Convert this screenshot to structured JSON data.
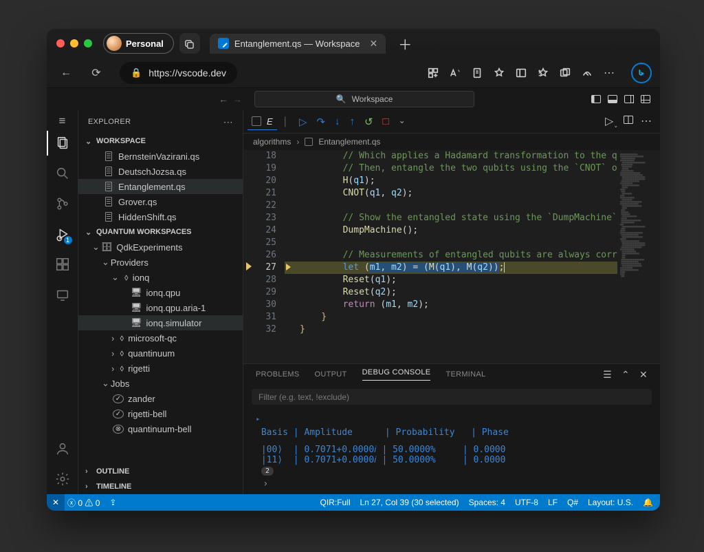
{
  "browser": {
    "profile_label": "Personal",
    "tab_title": "Entanglement.qs — Workspace",
    "url": "https://vscode.dev"
  },
  "vscode": {
    "command_center": "Workspace"
  },
  "explorer": {
    "title": "EXPLORER",
    "workspace_label": "WORKSPACE",
    "files": [
      "BernsteinVazirani.qs",
      "DeutschJozsa.qs",
      "Entanglement.qs",
      "Grover.qs",
      "HiddenShift.qs"
    ],
    "quantum_wksp_label": "QUANTUM WORKSPACES",
    "qdk_label": "QdkExperiments",
    "providers_label": "Providers",
    "jobs_label": "Jobs",
    "providers": {
      "ionq": {
        "label": "ionq",
        "targets": [
          "ionq.qpu",
          "ionq.qpu.aria-1",
          "ionq.simulator"
        ]
      },
      "msqc": "microsoft-qc",
      "quantinuum": "quantinuum",
      "rigetti": "rigetti"
    },
    "jobs": [
      {
        "name": "zander",
        "status": "ok"
      },
      {
        "name": "rigetti-bell",
        "status": "ok"
      },
      {
        "name": "quantinuum-bell",
        "status": "fail"
      }
    ],
    "outline_label": "OUTLINE",
    "timeline_label": "TIMELINE"
  },
  "editor": {
    "tab_label": "E",
    "breadcrumb": [
      "algorithms",
      "Entanglement.qs"
    ],
    "first_line_no": 18,
    "active_line": 27,
    "code": [
      {
        "pre": "        ",
        "tokens": [
          [
            "c-com",
            "// Which applies a Hadamard transformation to the q"
          ]
        ]
      },
      {
        "pre": "        ",
        "tokens": [
          [
            "c-com",
            "// Then, entangle the two qubits using the `CNOT` o"
          ]
        ]
      },
      {
        "pre": "        ",
        "tokens": [
          [
            "c-fn",
            "H"
          ],
          [
            "c-pun",
            "("
          ],
          [
            "c-var",
            "q1"
          ],
          [
            "c-pun",
            ");"
          ]
        ]
      },
      {
        "pre": "        ",
        "tokens": [
          [
            "c-fn",
            "CNOT"
          ],
          [
            "c-pun",
            "("
          ],
          [
            "c-var",
            "q1"
          ],
          [
            "c-pun",
            ", "
          ],
          [
            "c-var",
            "q2"
          ],
          [
            "c-pun",
            ");"
          ]
        ]
      },
      {
        "pre": "",
        "tokens": []
      },
      {
        "pre": "        ",
        "tokens": [
          [
            "c-com",
            "// Show the entangled state using the `DumpMachine`"
          ]
        ]
      },
      {
        "pre": "        ",
        "tokens": [
          [
            "c-fn",
            "DumpMachine"
          ],
          [
            "c-pun",
            "();"
          ]
        ]
      },
      {
        "pre": "",
        "tokens": []
      },
      {
        "pre": "        ",
        "tokens": [
          [
            "c-com",
            "// Measurements of entangled qubits are always corr"
          ]
        ]
      },
      {
        "pre": "        ",
        "hl": true,
        "tokens": [
          [
            "c-kwblue",
            "let "
          ],
          [
            "c-pun",
            "("
          ],
          [
            "c-var sel",
            "m1"
          ],
          [
            "c-pun sel",
            ", "
          ],
          [
            "c-var sel",
            "m2"
          ],
          [
            "c-pun sel",
            ") = ("
          ],
          [
            "c-fn sel",
            "M"
          ],
          [
            "c-pun sel",
            "("
          ],
          [
            "c-var sel",
            "q1"
          ],
          [
            "c-pun sel",
            "), "
          ],
          [
            "c-fn sel",
            "M"
          ],
          [
            "c-pun sel",
            "("
          ],
          [
            "c-var sel",
            "q2"
          ],
          [
            "c-pun sel",
            "))"
          ],
          [
            "c-pun cursor",
            ";"
          ]
        ]
      },
      {
        "pre": "        ",
        "tokens": [
          [
            "c-fn",
            "Reset"
          ],
          [
            "c-pun",
            "("
          ],
          [
            "c-var",
            "q1"
          ],
          [
            "c-pun",
            ");"
          ]
        ]
      },
      {
        "pre": "        ",
        "tokens": [
          [
            "c-fn",
            "Reset"
          ],
          [
            "c-pun",
            "("
          ],
          [
            "c-var",
            "q2"
          ],
          [
            "c-pun",
            ");"
          ]
        ]
      },
      {
        "pre": "        ",
        "tokens": [
          [
            "c-kw",
            "return "
          ],
          [
            "c-pun",
            "("
          ],
          [
            "c-var",
            "m1"
          ],
          [
            "c-pun",
            ", "
          ],
          [
            "c-var",
            "m2"
          ],
          [
            "c-pun",
            ");"
          ]
        ]
      },
      {
        "pre": "    ",
        "tokens": [
          [
            "c-yellow",
            "}"
          ]
        ]
      },
      {
        "pre": "",
        "tokens": [
          [
            "c-yellow",
            "}"
          ]
        ]
      }
    ]
  },
  "panel": {
    "tabs": [
      "PROBLEMS",
      "OUTPUT",
      "DEBUG CONSOLE",
      "TERMINAL"
    ],
    "active_tab": 2,
    "filter_placeholder": "Filter (e.g. text, !exclude)",
    "header": " Basis | Amplitude      | Probability   | Phase",
    "rows": [
      " |00⟩  | 0.7071+0.0000𝑖 | 50.0000%     | 0.0000",
      " |11⟩  | 0.7071+0.0000𝑖 | 50.0000%     | 0.0000"
    ],
    "repeat_count": "2"
  },
  "activity_badge": "1",
  "status": {
    "errors": "0",
    "warnings": "0",
    "qir": "QIR:Full",
    "cursor": "Ln 27, Col 39 (30 selected)",
    "spaces": "Spaces: 4",
    "encoding": "UTF-8",
    "eol": "LF",
    "lang": "Q#",
    "layout": "Layout: U.S."
  }
}
